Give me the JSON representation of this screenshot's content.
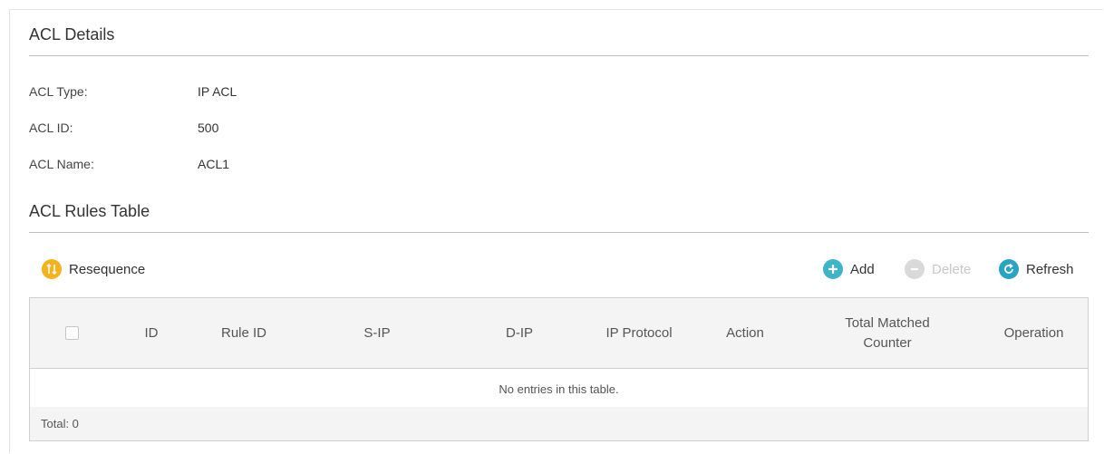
{
  "details": {
    "title": "ACL Details",
    "rows": [
      {
        "label": "ACL Type:",
        "value": "IP ACL"
      },
      {
        "label": "ACL ID:",
        "value": "500"
      },
      {
        "label": "ACL Name:",
        "value": "ACL1"
      }
    ]
  },
  "rules": {
    "title": "ACL Rules Table",
    "toolbar": {
      "resequence": "Resequence",
      "add": "Add",
      "delete": "Delete",
      "refresh": "Refresh"
    },
    "columns": [
      "ID",
      "Rule ID",
      "S-IP",
      "D-IP",
      "IP Protocol",
      "Action",
      "Total Matched Counter",
      "Operation"
    ],
    "empty_text": "No entries in this table.",
    "total": "Total: 0"
  },
  "colors": {
    "resequence_icon": "#f5b21b",
    "add_icon": "#3fb4c9",
    "delete_icon": "#d9d9d9",
    "refresh_icon": "#2aa3c4"
  }
}
